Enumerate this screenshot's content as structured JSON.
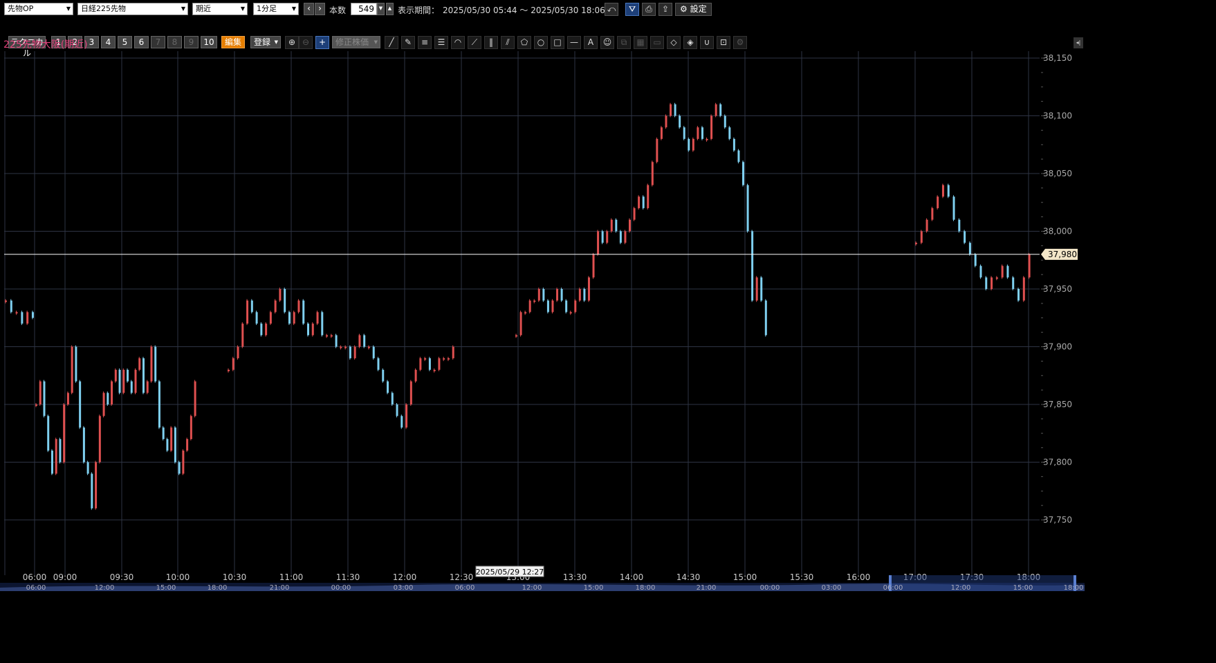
{
  "toolbar": {
    "category_select": "先物OP",
    "instrument_select": "日経225先物",
    "contract_select": "期近",
    "interval_select": "1分足",
    "prev_label": "‹",
    "next_label": "›",
    "bars_label": "本数",
    "bars_value": "549",
    "period_label": "表示期間：",
    "period_value": "2025/05/30 05:44 ～ 2025/05/30 18:06",
    "settings_label": "設定",
    "technical_label": "テクニカル",
    "slots": [
      "1",
      "2",
      "3",
      "4",
      "5",
      "6",
      "7",
      "8",
      "9",
      "10"
    ],
    "edit_label": "編集",
    "register_label": "登録",
    "adjusted_price_label": "修正株価"
  },
  "chart_title": "225先物大阪(期近)",
  "colors": {
    "up": "#e05050",
    "down": "#7fd0f0",
    "grid": "#2e3444",
    "current_line": "#ffffff",
    "price_tag_bg": "#f3e6c8",
    "title": "#e0407a"
  },
  "chart_data": {
    "type": "candlestick",
    "ylim": [
      37725,
      38150
    ],
    "yticks": [
      "37,750",
      "37,800",
      "37,850",
      "37,900",
      "37,950",
      "38,000",
      "38,050",
      "38,100",
      "38,150"
    ],
    "ytick_values": [
      37750,
      37800,
      37850,
      37900,
      37950,
      38000,
      38050,
      38100,
      38150
    ],
    "current_price": 37980,
    "current_price_label": "37,980",
    "xticks": [
      "06:00",
      "09:00",
      "09:30",
      "10:00",
      "10:30",
      "11:00",
      "11:30",
      "12:00",
      "12:30",
      "13:00",
      "13:30",
      "14:00",
      "14:30",
      "15:00",
      "15:30",
      "16:00",
      "17:00",
      "17:30",
      "18:00"
    ],
    "cursor_label": "2025/05/29 12:27",
    "nav_ticks": [
      "06:00",
      "12:00",
      "15:00",
      "18:00",
      "21:00",
      "00:00",
      "03:00",
      "06:00",
      "12:00",
      "15:00",
      "18:00",
      "21:00",
      "00:00",
      "03:00",
      "06:00",
      "12:00",
      "15:00",
      "18:00"
    ],
    "session_points": [
      {
        "t": "06:00",
        "v": [
          37940,
          37930,
          37930,
          37920,
          37930,
          37925
        ]
      },
      {
        "t": "09:00",
        "v": [
          37850,
          37870,
          37840,
          37810,
          37790,
          37820,
          37800,
          37850,
          37860,
          37900,
          37870,
          37830,
          37800,
          37790,
          37760,
          37800,
          37840,
          37860,
          37850,
          37870,
          37880,
          37860,
          37880,
          37870,
          37860,
          37880,
          37890,
          37860,
          37870,
          37900,
          37870,
          37830,
          37820,
          37810,
          37830,
          37800,
          37790,
          37810,
          37820,
          37840,
          37870
        ]
      },
      {
        "t": "10:30",
        "v": [
          37880,
          37890,
          37900,
          37920,
          37940,
          37930,
          37920,
          37910,
          37920,
          37930,
          37940,
          37950,
          37930,
          37920,
          37930,
          37940,
          37920,
          37910,
          37920,
          37930,
          37910,
          37910,
          37910,
          37900,
          37900,
          37900,
          37890,
          37900,
          37910,
          37900,
          37900,
          37890,
          37880,
          37870,
          37860,
          37850,
          37840,
          37830,
          37850,
          37870,
          37880,
          37890,
          37890,
          37880,
          37880,
          37890,
          37890,
          37890,
          37900
        ]
      },
      {
        "t": "13:00",
        "v": [
          37910,
          37930,
          37930,
          37940,
          37940,
          37950,
          37940,
          37930,
          37940,
          37950,
          37940,
          37930,
          37930,
          37940,
          37950,
          37940,
          37960,
          37980,
          38000,
          37990,
          38000,
          38010,
          38000,
          37990,
          38000,
          38010,
          38020,
          38030,
          38020,
          38040,
          38060,
          38080,
          38090,
          38100,
          38110,
          38100,
          38090,
          38080,
          38070,
          38080,
          38090,
          38080,
          38080,
          38100,
          38110,
          38100,
          38090,
          38080,
          38070,
          38060,
          38040,
          38000,
          37940,
          37960,
          37940,
          37910
        ]
      },
      {
        "t": "17:00",
        "v": [
          37990,
          38000,
          38010,
          38020,
          38030,
          38040,
          38030,
          38010,
          38000,
          37990,
          37980,
          37970,
          37960,
          37950,
          37960,
          37960,
          37970,
          37960,
          37950,
          37940,
          37960,
          37980
        ]
      }
    ]
  }
}
